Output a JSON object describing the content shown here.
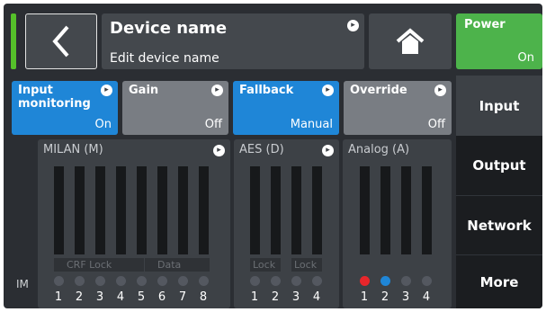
{
  "header": {
    "back_icon": "chevron-left-icon",
    "device_title": "Device name",
    "device_subtitle": "Edit device name",
    "home_icon": "home-icon",
    "power_label": "Power",
    "power_value": "On",
    "status_color": "#55c02a"
  },
  "top_buttons": [
    {
      "label": "Input monitoring",
      "value": "On",
      "color": "#1f86d7"
    },
    {
      "label": "Gain",
      "value": "Off",
      "color": "#797d83"
    },
    {
      "label": "Fallback",
      "value": "Manual",
      "color": "#1f86d7"
    },
    {
      "label": "Override",
      "value": "Off",
      "color": "#797d83"
    }
  ],
  "nav": [
    {
      "label": "Input",
      "active": true
    },
    {
      "label": "Output",
      "active": false
    },
    {
      "label": "Network",
      "active": false
    },
    {
      "label": "More",
      "active": false
    }
  ],
  "row_label": "IM",
  "panels": {
    "milan": {
      "title": "MILAN (M)",
      "status_labels": [
        "CRF Lock",
        "Data"
      ],
      "channels": [
        "1",
        "2",
        "3",
        "4",
        "5",
        "6",
        "7",
        "8"
      ]
    },
    "aes": {
      "title": "AES (D)",
      "status_labels": [
        "Lock",
        "Lock"
      ],
      "channels": [
        "1",
        "2",
        "3",
        "4"
      ]
    },
    "analog": {
      "title": "Analog (A)",
      "channels": [
        "1",
        "2",
        "3",
        "4"
      ],
      "led_colors": [
        "#e8262b",
        "#1f86d7",
        "#545860",
        "#545860"
      ]
    }
  }
}
